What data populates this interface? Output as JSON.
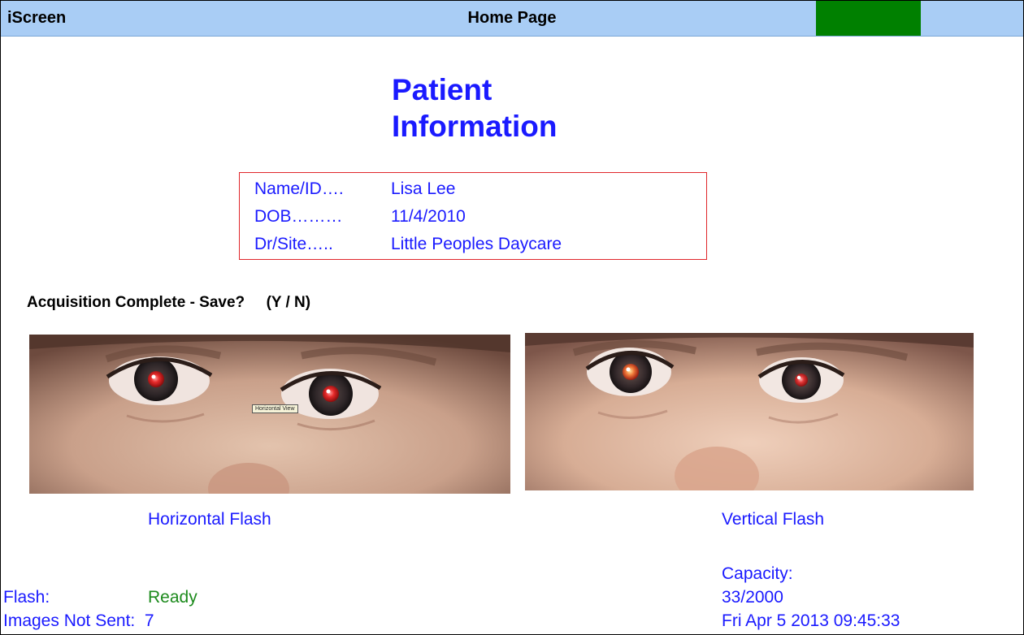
{
  "header": {
    "app_name": "iScreen",
    "page_name": "Home Page",
    "status_color": "#008000"
  },
  "patient": {
    "heading_line1": "Patient",
    "heading_line2": "Information",
    "name_label": "Name/ID….",
    "name_value": "Lisa Lee",
    "dob_label": "DOB………",
    "dob_value": "11/4/2010",
    "site_label": "Dr/Site…..",
    "site_value": "Little Peoples Daycare"
  },
  "acquisition": {
    "prompt": "Acquisition Complete - Save?",
    "options": "(Y / N)"
  },
  "images": {
    "horizontal_caption": "Horizontal Flash",
    "vertical_caption": "Vertical Flash",
    "tooltip": "Horizontal View"
  },
  "status": {
    "flash_label": "Flash:",
    "flash_value": "Ready",
    "images_not_sent_label": "Images Not Sent:",
    "images_not_sent_value": "7",
    "capacity_label": "Capacity:",
    "capacity_value": "33/2000",
    "datetime": "Fri Apr 5 2013 09:45:33"
  },
  "colors": {
    "title_bar": "#a9cdf5",
    "accent_blue": "#1a1aff",
    "ready_green": "#1c8a1c",
    "box_border": "#e0262b"
  }
}
